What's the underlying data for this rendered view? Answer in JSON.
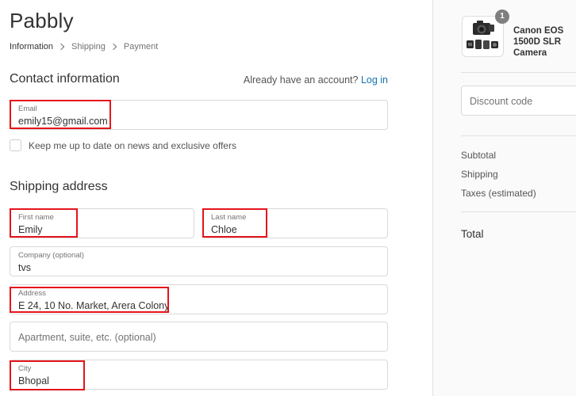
{
  "brand": "Pabbly",
  "breadcrumb": {
    "step1": "Information",
    "step2": "Shipping",
    "step3": "Payment"
  },
  "contact": {
    "title": "Contact information",
    "login_prompt": "Already have an account?",
    "login_link": "Log in",
    "email_label": "Email",
    "email_value": "emily15@gmail.com",
    "newsletter_label": "Keep me up to date on news and exclusive offers"
  },
  "shipping": {
    "title": "Shipping address",
    "first_name_label": "First name",
    "first_name_value": "Emily",
    "last_name_label": "Last name",
    "last_name_value": "Chloe",
    "company_label": "Company (optional)",
    "company_value": "tvs",
    "address_label": "Address",
    "address_value": "E 24, 10 No. Market, Arera Colony",
    "apartment_placeholder": "Apartment, suite, etc. (optional)",
    "city_label": "City",
    "city_value": "Bhopal"
  },
  "summary": {
    "quantity": "1",
    "product_name": "Canon EOS 1500D SLR Camera",
    "discount_placeholder": "Discount code",
    "subtotal_label": "Subtotal",
    "shipping_label": "Shipping",
    "taxes_label": "Taxes (estimated)",
    "total_label": "Total"
  },
  "colors": {
    "highlight": "#e5141b",
    "link": "#1773b0"
  }
}
